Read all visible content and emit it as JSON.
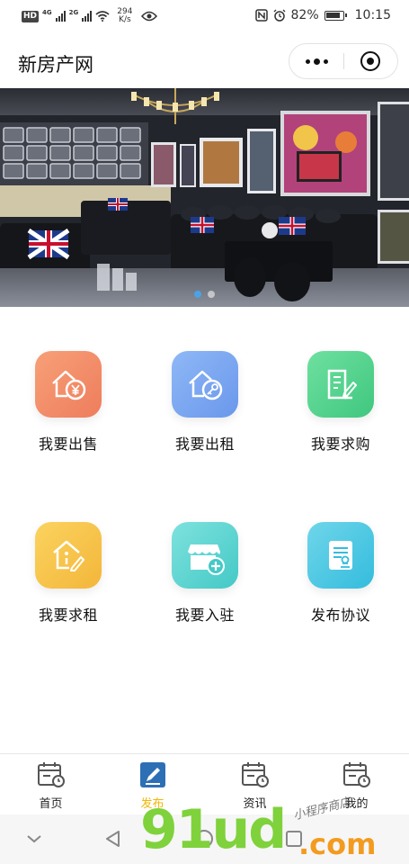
{
  "status_bar": {
    "hd": "HD",
    "net1": "4G",
    "net2": "2G",
    "speed_value": "294",
    "speed_unit": "K/s",
    "battery": "82%",
    "time": "10:15"
  },
  "title_bar": {
    "title": "新房产网"
  },
  "banner": {
    "slide_count": 2,
    "active_slide": 0
  },
  "grid": {
    "items": [
      {
        "label": "我要出售",
        "icon": "house-yen-icon",
        "color_from": "#f7a078",
        "color_to": "#ee7d5c"
      },
      {
        "label": "我要出租",
        "icon": "house-key-icon",
        "color_from": "#8fb8f6",
        "color_to": "#6a97ec"
      },
      {
        "label": "我要求购",
        "icon": "building-pen-icon",
        "color_from": "#6fe0a0",
        "color_to": "#3fc77f"
      },
      {
        "label": "我要求租",
        "icon": "house-pen-icon",
        "color_from": "#fbd35f",
        "color_to": "#f3b63a"
      },
      {
        "label": "我要入驻",
        "icon": "shop-plus-icon",
        "color_from": "#7ee2de",
        "color_to": "#44c9c6"
      },
      {
        "label": "发布协议",
        "icon": "document-stamp-icon",
        "color_from": "#6fd6ea",
        "color_to": "#34bcdd"
      }
    ]
  },
  "tab_bar": {
    "items": [
      {
        "label": "首页",
        "icon": "calendar-clock-icon"
      },
      {
        "label": "发布",
        "icon": "edit-icon"
      },
      {
        "label": "资讯",
        "icon": "calendar-clock-icon"
      },
      {
        "label": "我的",
        "icon": "calendar-clock-icon"
      }
    ],
    "active_index": 1,
    "active_color": "#f2b705"
  },
  "watermark": {
    "main": "91ud",
    "suffix": ".com",
    "script": "小程序商店"
  }
}
